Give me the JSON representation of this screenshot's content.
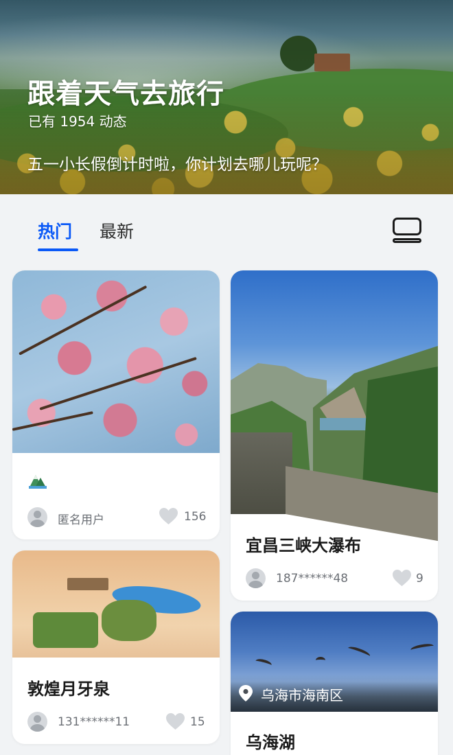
{
  "hero": {
    "title": "跟着天气去旅行",
    "count": "已有 1954 动态",
    "prompt": "五一小长假倒计时啦，你计划去哪儿玩呢？"
  },
  "tabs": [
    {
      "label": "热门",
      "active": true
    },
    {
      "label": "最新",
      "active": false
    }
  ],
  "colors": {
    "accent": "#0a59f7",
    "background": "#f1f3f5"
  },
  "cards": [
    {
      "title": "",
      "user": "匿名用户",
      "likes": "156",
      "image": "cherry-blossom-photo",
      "badge": "mountain-logo-icon"
    },
    {
      "title": "宜昌三峡大瀑布",
      "user": "187******48",
      "likes": "9",
      "image": "three-gorges-photo"
    },
    {
      "title": "敦煌月牙泉",
      "user": "131******11",
      "likes": "15",
      "image": "dunhuang-crescent-lake-photo"
    },
    {
      "title": "乌海湖",
      "location": "乌海市海南区",
      "image": "wuhai-lake-photo"
    }
  ]
}
